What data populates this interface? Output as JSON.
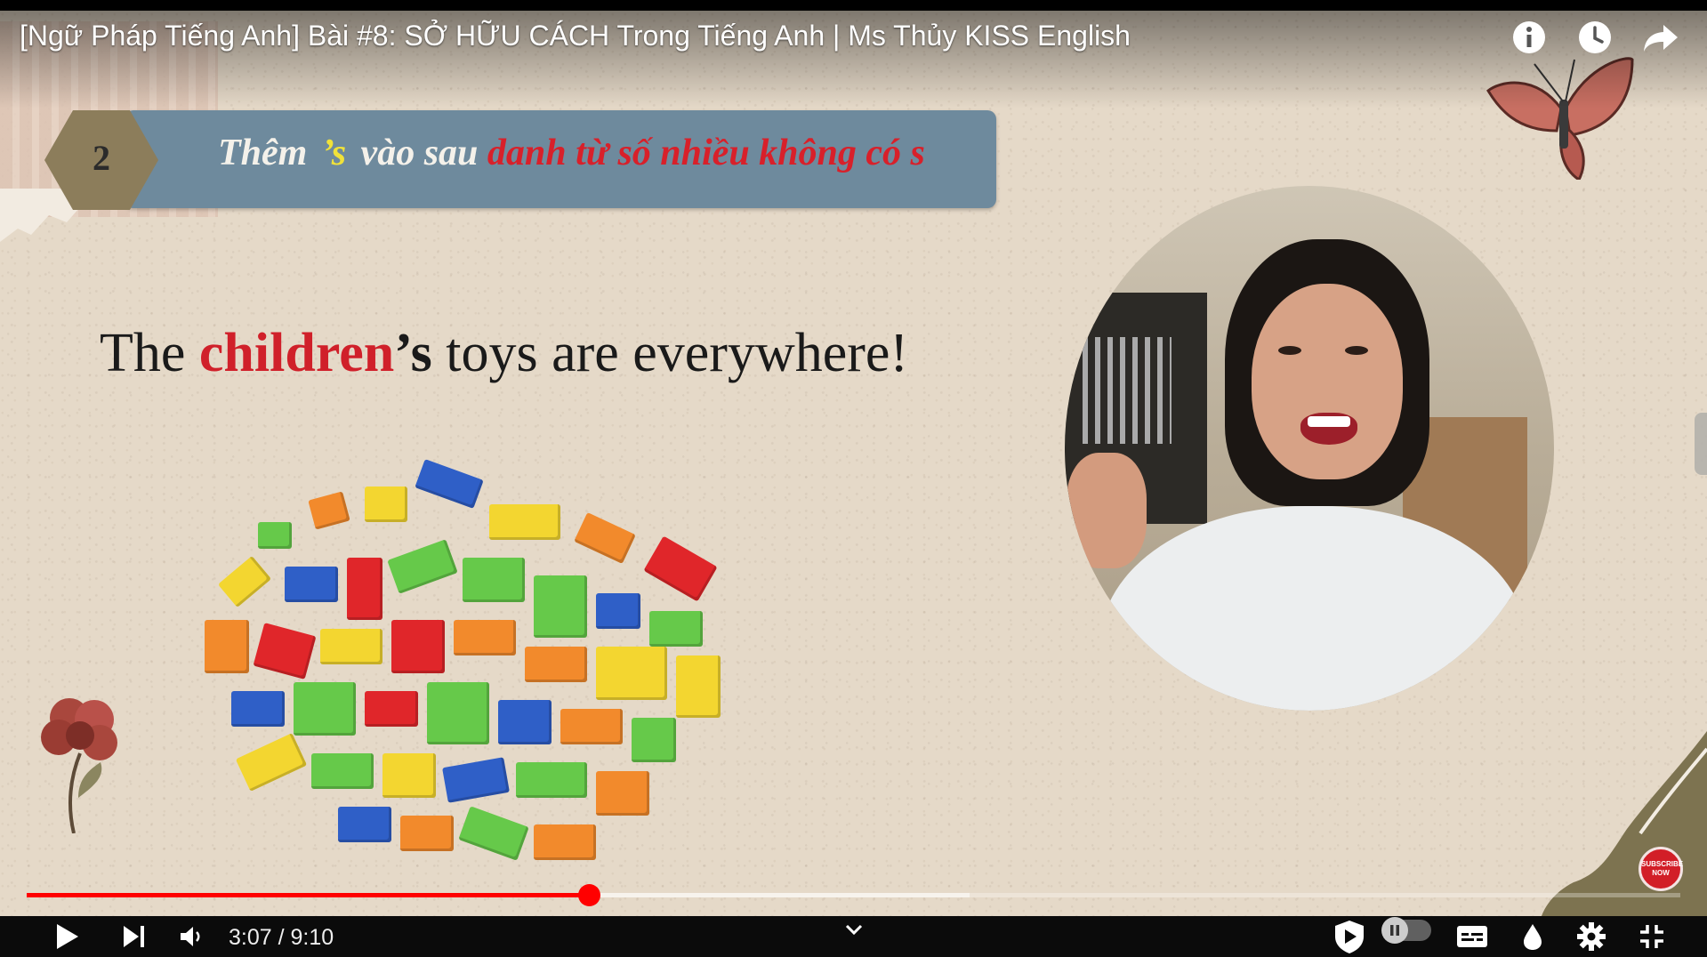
{
  "video": {
    "title": "[Ngữ Pháp Tiếng Anh] Bài #8: SỞ HỮU CÁCH Trong Tiếng Anh | Ms Thủy KISS English",
    "top_icons": [
      "info-icon",
      "watch-later-icon",
      "share-icon"
    ]
  },
  "slide": {
    "badge_number": "2",
    "heading": {
      "part1": "Thêm",
      "apostrophe": "’s",
      "part2": "vào sau",
      "highlight": "danh từ số nhiều không có s"
    },
    "sentence": {
      "before": "The ",
      "highlight": "children",
      "possessive": "’s",
      "after": " toys are everywhere!"
    },
    "subscribe": [
      "SUBSCRIBE",
      "NOW"
    ]
  },
  "player": {
    "current_time": "3:07",
    "duration": "9:10",
    "time_display": "3:07 / 9:10",
    "progress_played_fraction": 0.34,
    "progress_buffered_fraction": 0.57,
    "icons": [
      "play-icon",
      "next-icon",
      "volume-icon",
      "chevron-down-icon",
      "shield-icon",
      "autoplay-toggle-icon",
      "captions-icon",
      "ambient-icon",
      "settings-icon",
      "exit-fullscreen-icon"
    ]
  },
  "colors": {
    "accent_red": "#ff0000",
    "banner_blue": "#6e8a9d",
    "heading_red": "#d8202a",
    "apostrophe_yellow": "#f0e23a"
  }
}
